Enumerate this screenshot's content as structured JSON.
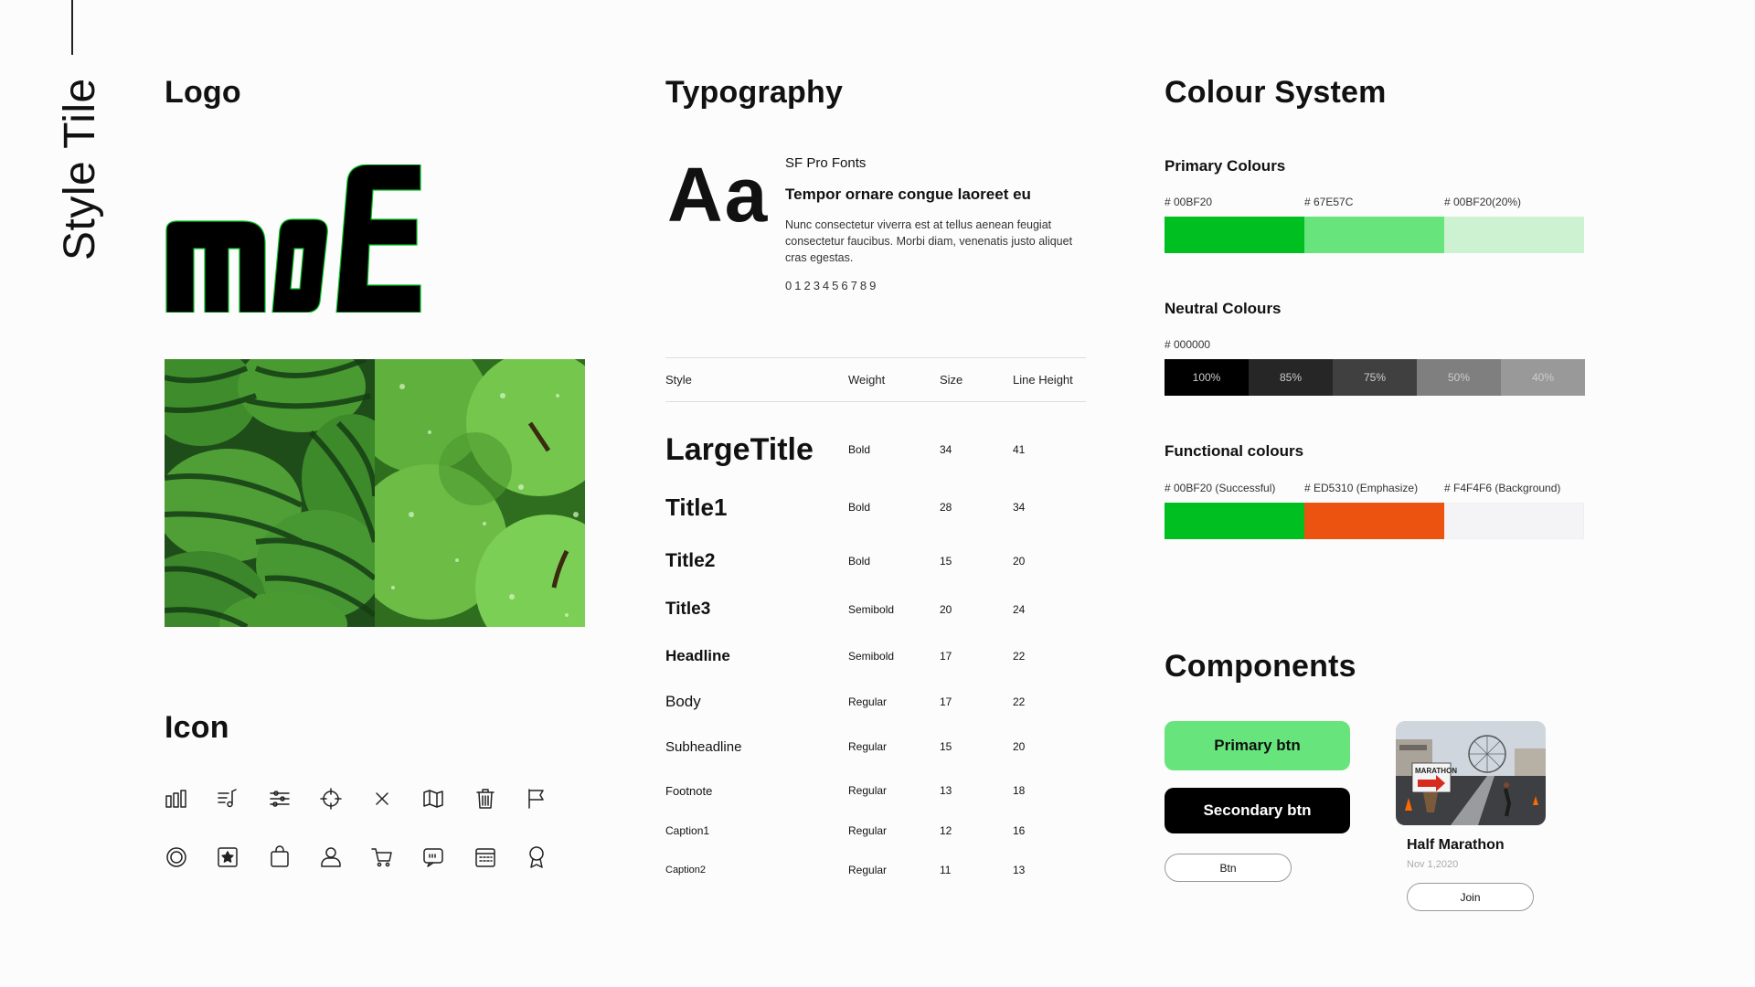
{
  "page_title": "Style Tile",
  "sections": {
    "logo": "Logo",
    "icon": "Icon",
    "typography": "Typography",
    "colour_system": "Colour System",
    "components": "Components"
  },
  "logo": {
    "text": "mOE",
    "colors": {
      "fill": "#000000",
      "edge": "#00BF20"
    }
  },
  "photos": [
    {
      "name": "watermelons-photo",
      "colors": [
        "#1d5a1f",
        "#5aa83a"
      ]
    },
    {
      "name": "green-apples-photo",
      "colors": [
        "#3a9a2a",
        "#8ed66a"
      ]
    }
  ],
  "icons": [
    [
      "bar-chart-icon",
      "music-note-icon",
      "sliders-icon",
      "crosshair-icon",
      "close-icon",
      "map-icon",
      "trash-icon",
      "flag-icon"
    ],
    [
      "radio-target-icon",
      "star-badge-icon",
      "shopping-bag-icon",
      "user-icon",
      "cart-icon",
      "chat-bubble-icon",
      "calendar-icon",
      "award-icon"
    ]
  ],
  "typography": {
    "sample_glyph": "Aa",
    "font_name": "SF Pro Fonts",
    "sample_title": "Tempor ornare congue laoreet eu",
    "sample_body": "Nunc consectetur viverra est at tellus aenean feugiat consectetur faucibus. Morbi diam, venenatis justo aliquet cras egestas.",
    "digits": "0123456789",
    "headers": {
      "style": "Style",
      "weight": "Weight",
      "size": "Size",
      "line_height": "Line Height"
    },
    "rows": [
      {
        "style": "LargeTitle",
        "weight": "Bold",
        "size": "34",
        "line_height": "41"
      },
      {
        "style": "Title1",
        "weight": "Bold",
        "size": "28",
        "line_height": "34"
      },
      {
        "style": "Title2",
        "weight": "Bold",
        "size": "15",
        "line_height": "20"
      },
      {
        "style": "Title3",
        "weight": "Semibold",
        "size": "20",
        "line_height": "24"
      },
      {
        "style": "Headline",
        "weight": "Semibold",
        "size": "17",
        "line_height": "22"
      },
      {
        "style": "Body",
        "weight": "Regular",
        "size": "17",
        "line_height": "22"
      },
      {
        "style": "Subheadline",
        "weight": "Regular",
        "size": "15",
        "line_height": "20"
      },
      {
        "style": "Footnote",
        "weight": "Regular",
        "size": "13",
        "line_height": "18"
      },
      {
        "style": "Caption1",
        "weight": "Regular",
        "size": "12",
        "line_height": "16"
      },
      {
        "style": "Caption2",
        "weight": "Regular",
        "size": "11",
        "line_height": "13"
      }
    ]
  },
  "colours": {
    "primary": {
      "title": "Primary Colours",
      "labels": [
        "# 00BF20",
        "# 67E57C",
        "# 00BF20(20%)"
      ],
      "swatches": [
        "#00BF20",
        "#67E57C",
        "#CCF2D2"
      ]
    },
    "neutral": {
      "title": "Neutral Colours",
      "label": "# 000000",
      "swatches": [
        {
          "label": "100%",
          "color": "#000000"
        },
        {
          "label": "85%",
          "color": "#262626"
        },
        {
          "label": "75%",
          "color": "#404040"
        },
        {
          "label": "50%",
          "color": "#7f7f7f"
        },
        {
          "label": "40%",
          "color": "#999999"
        }
      ]
    },
    "functional": {
      "title": "Functional colours",
      "labels": [
        "# 00BF20 (Successful)",
        "# ED5310 (Emphasize)",
        "# F4F4F6 (Background)"
      ],
      "swatches": [
        "#00BF20",
        "#ED5310",
        "#F4F4F6"
      ]
    }
  },
  "components": {
    "primary_btn": "Primary btn",
    "secondary_btn": "Secondary btn",
    "small_btn": "Btn",
    "card": {
      "title": "Half Marathon",
      "date": "Nov 1,2020",
      "sign_text": "MARATHON",
      "join": "Join"
    }
  }
}
